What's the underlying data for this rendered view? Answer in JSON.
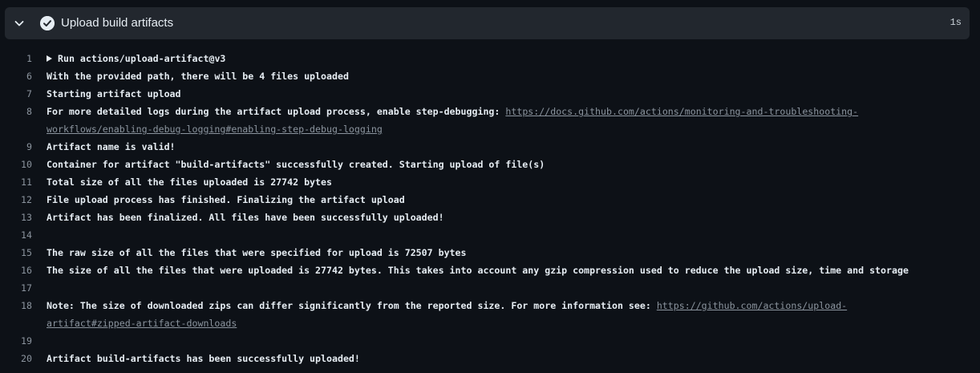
{
  "step": {
    "title": "Upload build artifacts",
    "duration": "1s",
    "status": "success"
  },
  "log": {
    "line1": {
      "num": "1",
      "text": "Run actions/upload-artifact@v3"
    },
    "line6": {
      "num": "6",
      "text": "With the provided path, there will be 4 files uploaded"
    },
    "line7": {
      "num": "7",
      "text": "Starting artifact upload"
    },
    "line8": {
      "num": "8",
      "text": "For more detailed logs during the artifact upload process, enable step-debugging: ",
      "link_part1": "https://docs.github.com/actions/monitoring-and-troubleshooting-",
      "link_part2": "workflows/enabling-debug-logging#enabling-step-debug-logging"
    },
    "line9": {
      "num": "9",
      "text": "Artifact name is valid!"
    },
    "line10": {
      "num": "10",
      "text": "Container for artifact \"build-artifacts\" successfully created. Starting upload of file(s)"
    },
    "line11": {
      "num": "11",
      "text": "Total size of all the files uploaded is 27742 bytes"
    },
    "line12": {
      "num": "12",
      "text": "File upload process has finished. Finalizing the artifact upload"
    },
    "line13": {
      "num": "13",
      "text": "Artifact has been finalized. All files have been successfully uploaded!"
    },
    "line14": {
      "num": "14",
      "text": ""
    },
    "line15": {
      "num": "15",
      "text": "The raw size of all the files that were specified for upload is 72507 bytes"
    },
    "line16": {
      "num": "16",
      "text": "The size of all the files that were uploaded is 27742 bytes. This takes into account any gzip compression used to reduce the upload size, time and storage"
    },
    "line17": {
      "num": "17",
      "text": ""
    },
    "line18": {
      "num": "18",
      "text": "Note: The size of downloaded zips can differ significantly from the reported size. For more information see: ",
      "link_part1": "https://github.com/actions/upload-",
      "link_part2": "artifact#zipped-artifact-downloads"
    },
    "line19": {
      "num": "19",
      "text": ""
    },
    "line20": {
      "num": "20",
      "text": "Artifact build-artifacts has been successfully uploaded!"
    }
  },
  "icons": {
    "chevron": "chevron-down-icon",
    "status": "check-circle-icon"
  },
  "colors": {
    "background": "#0d1117",
    "header_bg": "#22272e",
    "text": "#e6edf3",
    "muted": "#8b949e"
  }
}
